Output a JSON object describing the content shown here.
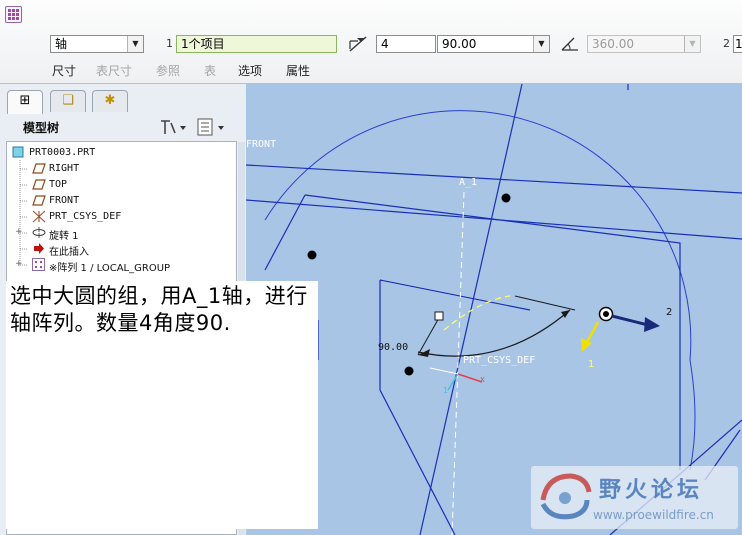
{
  "toolbar": {
    "pattern_type": "轴",
    "ref_count_label": "1",
    "ref_value": "1个项目",
    "member_count": "4",
    "angle_value": "90.00",
    "total_angle": "360.00",
    "second_dir_label": "2",
    "second_dir_value": "1"
  },
  "tabs": [
    {
      "label": "尺寸",
      "enabled": true
    },
    {
      "label": "表尺寸",
      "enabled": false
    },
    {
      "label": "参照",
      "enabled": false
    },
    {
      "label": "表",
      "enabled": false
    },
    {
      "label": "选项",
      "enabled": true
    },
    {
      "label": "属性",
      "enabled": true
    }
  ],
  "model_tree": {
    "title": "模型树",
    "items": [
      {
        "icon": "part-icon",
        "label": "PRT0003.PRT"
      },
      {
        "icon": "datum-plane-icon",
        "label": "RIGHT"
      },
      {
        "icon": "datum-plane-icon",
        "label": "TOP"
      },
      {
        "icon": "datum-plane-icon",
        "label": "FRONT"
      },
      {
        "icon": "csys-icon",
        "label": "PRT_CSYS_DEF"
      },
      {
        "icon": "revolve-icon",
        "label": "旋转 1"
      },
      {
        "icon": "insert-here-icon",
        "label": "在此插入"
      },
      {
        "icon": "pattern-icon",
        "label": "※阵列 1 / LOCAL_GROUP"
      }
    ]
  },
  "annotation": "选中大圆的组，用A_1轴，进行轴阵列。数量4角度90.",
  "viewport": {
    "labels": {
      "front": "FRONT",
      "axis": "A_1",
      "angle_dim": "90.00",
      "csys": "PRT_CSYS_DEF",
      "direction1": "1",
      "direction2": "2",
      "csys_z": "1",
      "csys_x": "X"
    }
  },
  "watermark": {
    "title": "野火论坛",
    "url": "www.proewildfire.cn"
  },
  "colors": {
    "viewport_bg": "#a8c5e6",
    "geometry": "#1a2fb8",
    "dimension": "#ffff66",
    "direction_arrow": "#1a2a7a",
    "dir1_arrow": "#f0e000"
  }
}
